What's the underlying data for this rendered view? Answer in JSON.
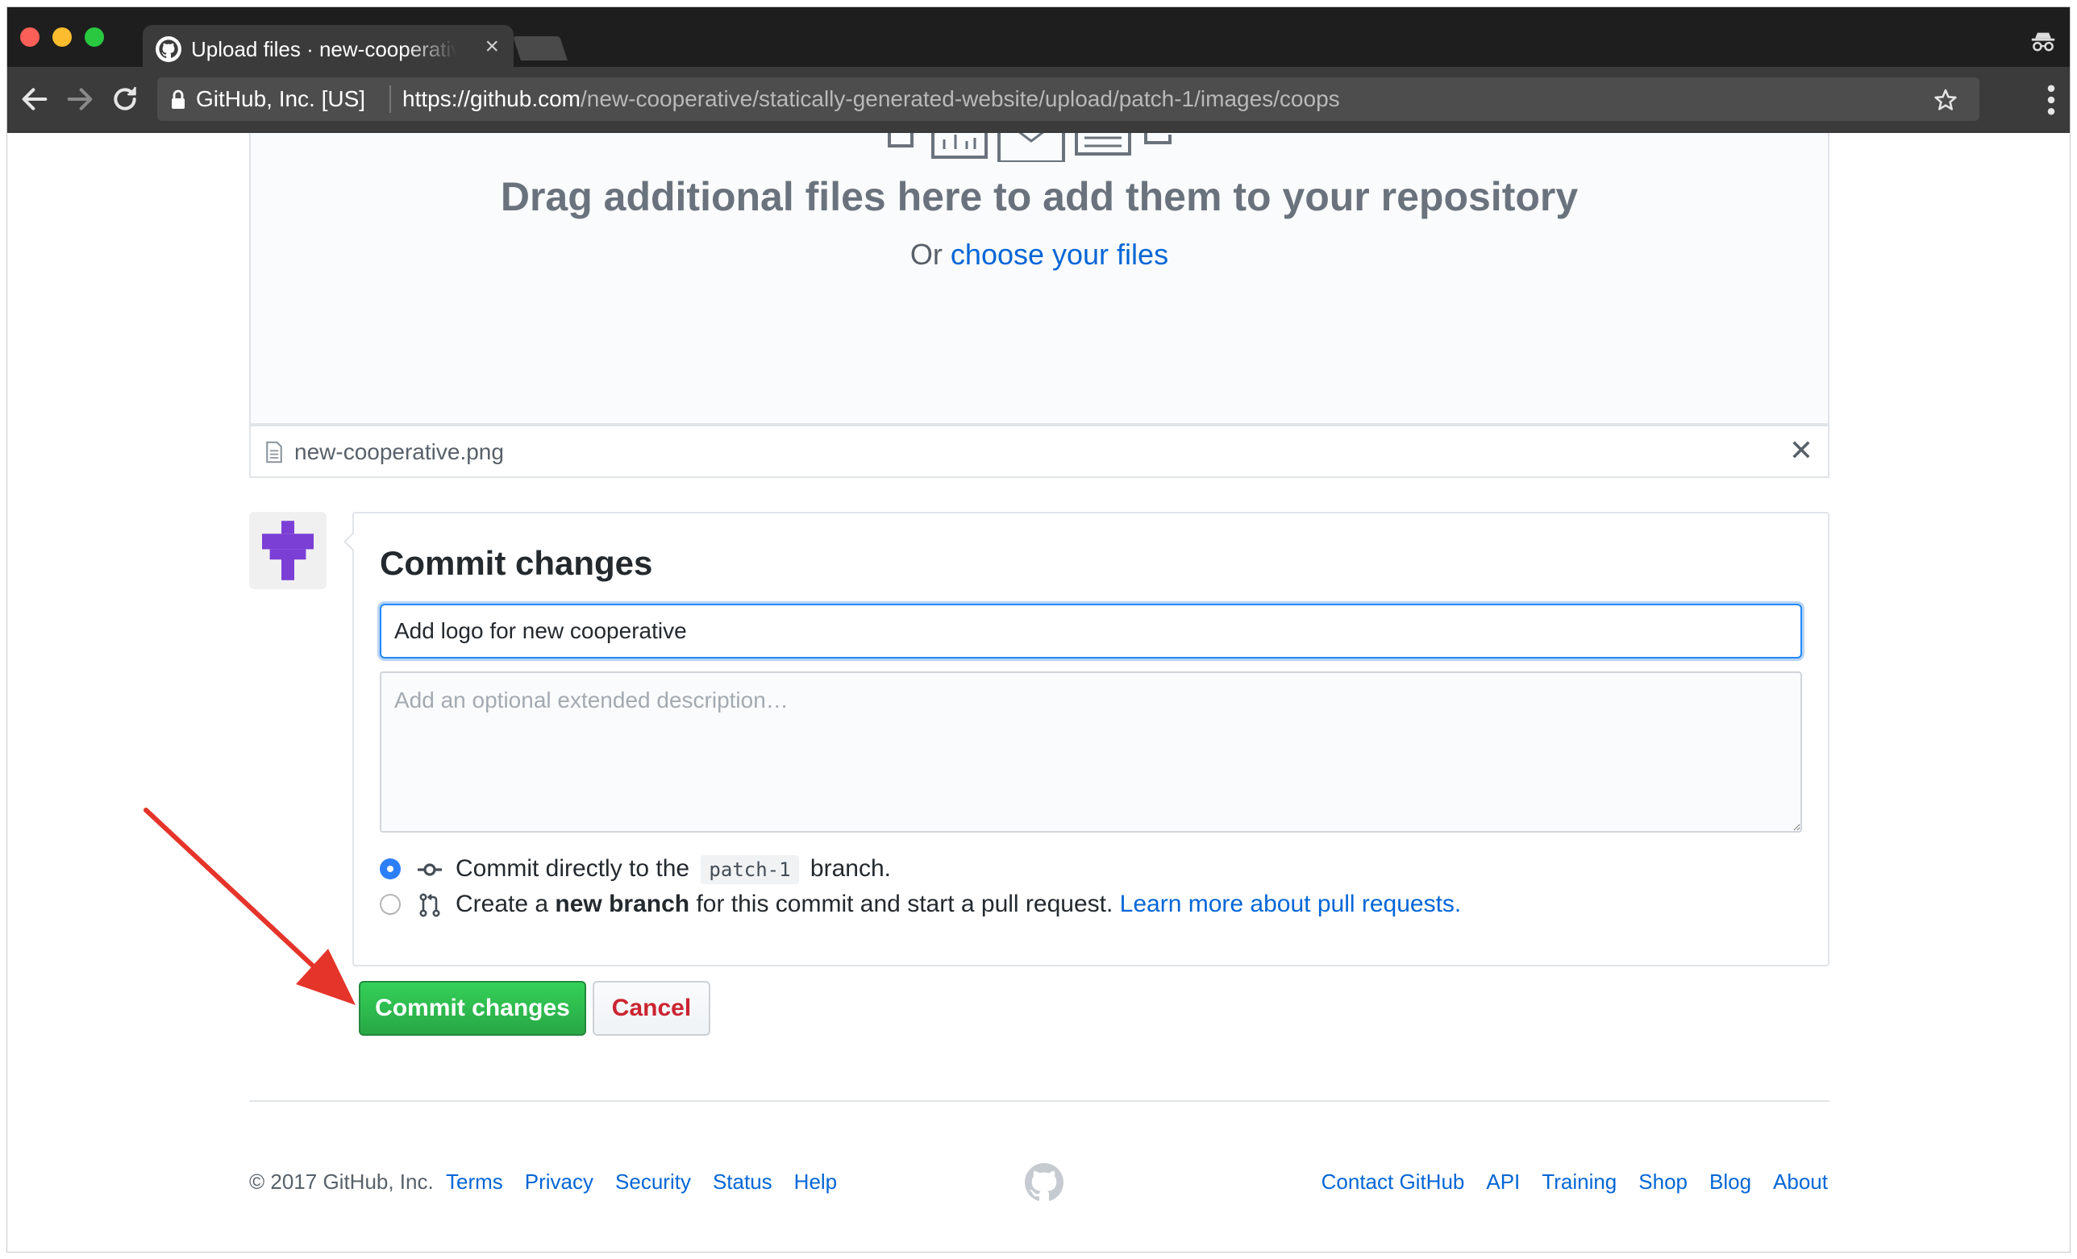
{
  "browser": {
    "tab_title": "Upload files · new-cooperative/statically-generated-website",
    "tab_close": "×",
    "security_org": "GitHub, Inc. [US]",
    "url_origin": "https://github.com",
    "url_path": "/new-cooperative/statically-generated-website/upload/patch-1/images/coops"
  },
  "dropzone": {
    "title": "Drag additional files here to add them to your repository",
    "or_text": "Or ",
    "choose_link": "choose your files"
  },
  "uploaded_file": {
    "name": "new-cooperative.png",
    "remove_label": "✕"
  },
  "commit": {
    "heading": "Commit changes",
    "summary_value": "Add logo for new cooperative",
    "description_placeholder": "Add an optional extended description…",
    "option_direct": {
      "before": "Commit directly to the ",
      "branch": "patch-1",
      "after": " branch."
    },
    "option_new_branch": {
      "before": "Create a ",
      "bold": "new branch",
      "after": " for this commit and start a pull request. ",
      "link": "Learn more about pull requests."
    },
    "submit_label": "Commit changes",
    "cancel_label": "Cancel"
  },
  "footer": {
    "copyright": "© 2017 GitHub, Inc.",
    "left_links": [
      "Terms",
      "Privacy",
      "Security",
      "Status",
      "Help"
    ],
    "right_links": [
      "Contact GitHub",
      "API",
      "Training",
      "Shop",
      "Blog",
      "About"
    ]
  },
  "colors": {
    "primary_button": "#28a745",
    "link": "#0366d6",
    "danger": "#cb2431",
    "annotation_arrow": "#e5342a",
    "avatar": "#7b3fd6"
  },
  "icons": [
    "github-icon",
    "incognito-icon",
    "back-icon",
    "forward-icon",
    "reload-icon",
    "lock-icon",
    "star-icon",
    "menu-icon",
    "file-icon",
    "commit-icon",
    "pull-request-icon"
  ]
}
